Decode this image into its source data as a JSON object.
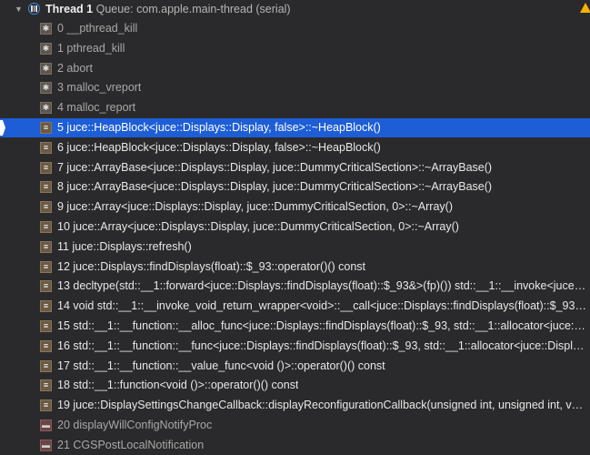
{
  "thread": {
    "name": "Thread 1",
    "queue": "Queue: com.apple.main-thread (serial)"
  },
  "frames": [
    {
      "label": "0 __pthread_kill",
      "kind": "sys"
    },
    {
      "label": "1 pthread_kill",
      "kind": "sys"
    },
    {
      "label": "2 abort",
      "kind": "sys"
    },
    {
      "label": "3 malloc_vreport",
      "kind": "sys"
    },
    {
      "label": "4 malloc_report",
      "kind": "sys"
    },
    {
      "label": "5 juce::HeapBlock<juce::Displays::Display, false>::~HeapBlock()",
      "kind": "user",
      "selected": true
    },
    {
      "label": "6 juce::HeapBlock<juce::Displays::Display, false>::~HeapBlock()",
      "kind": "user"
    },
    {
      "label": "7 juce::ArrayBase<juce::Displays::Display, juce::DummyCriticalSection>::~ArrayBase()",
      "kind": "user"
    },
    {
      "label": "8 juce::ArrayBase<juce::Displays::Display, juce::DummyCriticalSection>::~ArrayBase()",
      "kind": "user"
    },
    {
      "label": "9 juce::Array<juce::Displays::Display, juce::DummyCriticalSection, 0>::~Array()",
      "kind": "user"
    },
    {
      "label": "10 juce::Array<juce::Displays::Display, juce::DummyCriticalSection, 0>::~Array()",
      "kind": "user"
    },
    {
      "label": "11 juce::Displays::refresh()",
      "kind": "user"
    },
    {
      "label": "12 juce::Displays::findDisplays(float)::$_93::operator()() const",
      "kind": "user"
    },
    {
      "label": "13 decltype(std::__1::forward<juce::Displays::findDisplays(float)::$_93&>(fp)()) std::__1::__invoke<juce::Di...",
      "kind": "user"
    },
    {
      "label": "14 void std::__1::__invoke_void_return_wrapper<void>::__call<juce::Displays::findDisplays(float)::$_93&>(j...",
      "kind": "user"
    },
    {
      "label": "15 std::__1::__function::__alloc_func<juce::Displays::findDisplays(float)::$_93, std::__1::allocator<juce::Dis...",
      "kind": "user"
    },
    {
      "label": "16 std::__1::__function::__func<juce::Displays::findDisplays(float)::$_93, std::__1::allocator<juce::Displays::...",
      "kind": "user"
    },
    {
      "label": "17 std::__1::__function::__value_func<void ()>::operator()() const",
      "kind": "user"
    },
    {
      "label": "18 std::__1::function<void ()>::operator()() const",
      "kind": "user"
    },
    {
      "label": "19 juce::DisplaySettingsChangeCallback::displayReconfigurationCallback(unsigned int, unsigned int, voi...",
      "kind": "user"
    },
    {
      "label": "20 displayWillConfigNotifyProc",
      "kind": "lib"
    },
    {
      "label": "21 CGSPostLocalNotification",
      "kind": "lib"
    }
  ]
}
